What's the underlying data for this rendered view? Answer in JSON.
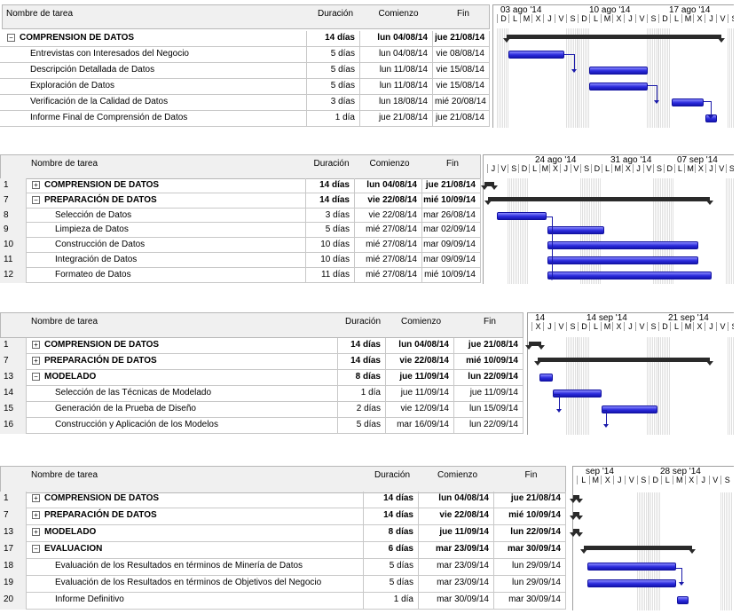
{
  "panels": [
    {
      "headers": {
        "name": "Nombre de tarea",
        "duration": "Duración",
        "start": "Comienzo",
        "end": "Fin"
      },
      "timeline": [
        "03 ago '14",
        "10 ago '14",
        "17 ago '14"
      ],
      "days": [
        "D",
        "L",
        "M",
        "X",
        "J",
        "V",
        "S",
        "D",
        "L",
        "M",
        "X",
        "J",
        "V",
        "S",
        "D",
        "L",
        "M",
        "X",
        "J",
        "V",
        "S"
      ],
      "rows": [
        {
          "id": "",
          "name": "COMPRENSION DE DATOS",
          "duration": "14 días",
          "start": "lun 04/08/14",
          "end": "jue 21/08/14",
          "summary": true,
          "toggle": "−"
        },
        {
          "id": "",
          "name": "Entrevistas con Interesados del Negocio",
          "duration": "5 días",
          "start": "lun 04/08/14",
          "end": "vie 08/08/14"
        },
        {
          "id": "",
          "name": "Descripción Detallada de Datos",
          "duration": "5 días",
          "start": "lun 11/08/14",
          "end": "vie 15/08/14"
        },
        {
          "id": "",
          "name": "Exploración de Datos",
          "duration": "5 días",
          "start": "lun 11/08/14",
          "end": "vie 15/08/14"
        },
        {
          "id": "",
          "name": "Verificación de la Calidad de Datos",
          "duration": "3 días",
          "start": "lun 18/08/14",
          "end": "mié 20/08/14"
        },
        {
          "id": "",
          "name": "Informe Final de Comprensión de Datos",
          "duration": "1 día",
          "start": "jue 21/08/14",
          "end": "jue 21/08/14"
        }
      ]
    },
    {
      "headers": {
        "name": "Nombre de tarea",
        "duration": "Duración",
        "start": "Comienzo",
        "end": "Fin"
      },
      "timeline": [
        "24 ago '14",
        "31 ago '14",
        "07 sep '14"
      ],
      "days": [
        "J",
        "V",
        "S",
        "D",
        "L",
        "M",
        "X",
        "J",
        "V",
        "S",
        "D",
        "L",
        "M",
        "X",
        "J",
        "V",
        "S",
        "D",
        "L",
        "M",
        "X",
        "J",
        "V",
        "S"
      ],
      "rows": [
        {
          "id": "1",
          "name": "COMPRENSION DE DATOS",
          "duration": "14 días",
          "start": "lun 04/08/14",
          "end": "jue 21/08/14",
          "summary": true,
          "toggle": "+"
        },
        {
          "id": "7",
          "name": "PREPARACIÓN DE DATOS",
          "duration": "14 días",
          "start": "vie 22/08/14",
          "end": "mié 10/09/14",
          "summary": true,
          "toggle": "−"
        },
        {
          "id": "8",
          "name": "Selección de Datos",
          "duration": "3 días",
          "start": "vie 22/08/14",
          "end": "mar 26/08/14"
        },
        {
          "id": "9",
          "name": "Limpieza de Datos",
          "duration": "5 días",
          "start": "mié 27/08/14",
          "end": "mar 02/09/14"
        },
        {
          "id": "10",
          "name": "Construcción de Datos",
          "duration": "10 días",
          "start": "mié 27/08/14",
          "end": "mar 09/09/14"
        },
        {
          "id": "11",
          "name": "Integración de Datos",
          "duration": "10 días",
          "start": "mié 27/08/14",
          "end": "mar 09/09/14"
        },
        {
          "id": "12",
          "name": "Formateo de Datos",
          "duration": "11 días",
          "start": "mié 27/08/14",
          "end": "mié 10/09/14"
        }
      ]
    },
    {
      "headers": {
        "name": "Nombre de tarea",
        "duration": "Duración",
        "start": "Comienzo",
        "end": "Fin"
      },
      "timeline": [
        "14",
        "14 sep '14",
        "21 sep '14"
      ],
      "days": [
        "X",
        "J",
        "V",
        "S",
        "D",
        "L",
        "M",
        "X",
        "J",
        "V",
        "S",
        "D",
        "L",
        "M",
        "X",
        "J",
        "V",
        "S"
      ],
      "rows": [
        {
          "id": "1",
          "name": "COMPRENSION DE DATOS",
          "duration": "14 días",
          "start": "lun 04/08/14",
          "end": "jue 21/08/14",
          "summary": true,
          "toggle": "+"
        },
        {
          "id": "7",
          "name": "PREPARACIÓN DE DATOS",
          "duration": "14 días",
          "start": "vie 22/08/14",
          "end": "mié 10/09/14",
          "summary": true,
          "toggle": "+"
        },
        {
          "id": "13",
          "name": "MODELADO",
          "duration": "8 días",
          "start": "jue 11/09/14",
          "end": "lun 22/09/14",
          "summary": true,
          "toggle": "−"
        },
        {
          "id": "14",
          "name": "Selección de las Técnicas de Modelado",
          "duration": "1 día",
          "start": "jue 11/09/14",
          "end": "jue 11/09/14"
        },
        {
          "id": "15",
          "name": "Generación de la Prueba de Diseño",
          "duration": "2 días",
          "start": "vie 12/09/14",
          "end": "lun 15/09/14"
        },
        {
          "id": "16",
          "name": "Construcción y Aplicación de los Modelos",
          "duration": "5 días",
          "start": "mar 16/09/14",
          "end": "lun 22/09/14"
        }
      ]
    },
    {
      "headers": {
        "name": "Nombre de tarea",
        "duration": "Duración",
        "start": "Comienzo",
        "end": "Fin"
      },
      "timeline": [
        "sep '14",
        "28 sep '14"
      ],
      "days": [
        "L",
        "M",
        "X",
        "J",
        "V",
        "S",
        "D",
        "L",
        "M",
        "X",
        "J",
        "V",
        "S"
      ],
      "rows": [
        {
          "id": "1",
          "name": "COMPRENSION DE DATOS",
          "duration": "14 días",
          "start": "lun 04/08/14",
          "end": "jue 21/08/14",
          "summary": true,
          "toggle": "+"
        },
        {
          "id": "7",
          "name": "PREPARACIÓN DE DATOS",
          "duration": "14 días",
          "start": "vie 22/08/14",
          "end": "mié 10/09/14",
          "summary": true,
          "toggle": "+"
        },
        {
          "id": "13",
          "name": "MODELADO",
          "duration": "8 días",
          "start": "jue 11/09/14",
          "end": "lun 22/09/14",
          "summary": true,
          "toggle": "+"
        },
        {
          "id": "17",
          "name": "EVALUACION",
          "duration": "6 días",
          "start": "mar 23/09/14",
          "end": "mar 30/09/14",
          "summary": true,
          "toggle": "−"
        },
        {
          "id": "18",
          "name": "Evaluación de los Resultados en términos de Minería de Datos",
          "duration": "5 días",
          "start": "mar 23/09/14",
          "end": "lun 29/09/14"
        },
        {
          "id": "19",
          "name": "Evaluación de los Resultados en términos de Objetivos del Negocio",
          "duration": "5 días",
          "start": "mar 23/09/14",
          "end": "lun 29/09/14"
        },
        {
          "id": "20",
          "name": "Informe Definitivo",
          "duration": "1 día",
          "start": "mar 30/09/14",
          "end": "mar 30/09/14"
        }
      ]
    }
  ],
  "colors": {
    "task_bar": "#2b2bdc",
    "summary_bar": "#2a2a2a",
    "link": "#1a1aaa",
    "header_bg": "#f0f0f0"
  }
}
